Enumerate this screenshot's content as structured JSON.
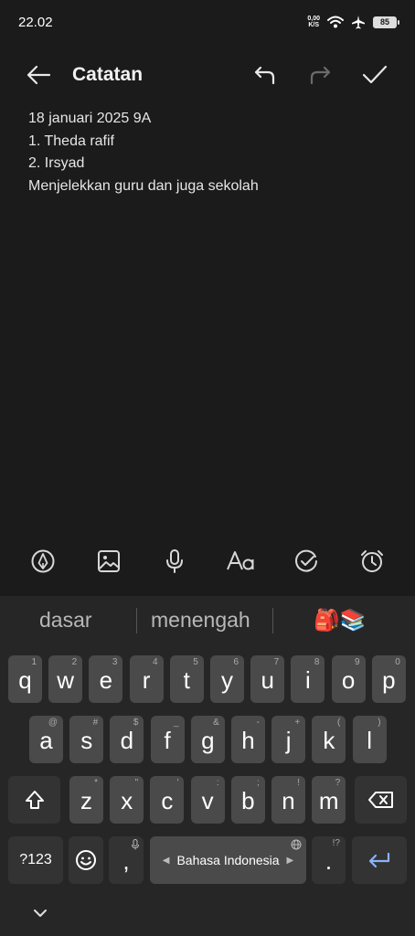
{
  "status_bar": {
    "time": "22.02",
    "net_speed_value": "0,00",
    "net_speed_unit": "K/S",
    "battery": "85"
  },
  "app_bar": {
    "title": "Catatan"
  },
  "note": {
    "lines": [
      "18 januari 2025 9A",
      "1. Theda rafif",
      "2. Irsyad",
      "Menjelekkan guru dan juga sekolah"
    ]
  },
  "keyboard": {
    "suggestions": [
      "dasar",
      "menengah",
      "🎒📚"
    ],
    "row1": [
      {
        "k": "q",
        "h": "1"
      },
      {
        "k": "w",
        "h": "2"
      },
      {
        "k": "e",
        "h": "3"
      },
      {
        "k": "r",
        "h": "4"
      },
      {
        "k": "t",
        "h": "5"
      },
      {
        "k": "y",
        "h": "6"
      },
      {
        "k": "u",
        "h": "7"
      },
      {
        "k": "i",
        "h": "8"
      },
      {
        "k": "o",
        "h": "9"
      },
      {
        "k": "p",
        "h": "0"
      }
    ],
    "row2": [
      {
        "k": "a",
        "h": "@"
      },
      {
        "k": "s",
        "h": "#"
      },
      {
        "k": "d",
        "h": "$"
      },
      {
        "k": "f",
        "h": "_"
      },
      {
        "k": "g",
        "h": "&"
      },
      {
        "k": "h",
        "h": "-"
      },
      {
        "k": "j",
        "h": "+"
      },
      {
        "k": "k",
        "h": "("
      },
      {
        "k": "l",
        "h": ")"
      }
    ],
    "row3": [
      {
        "k": "z",
        "h": "*"
      },
      {
        "k": "x",
        "h": "\""
      },
      {
        "k": "c",
        "h": "'"
      },
      {
        "k": "v",
        "h": ":"
      },
      {
        "k": "b",
        "h": ";"
      },
      {
        "k": "n",
        "h": "!"
      },
      {
        "k": "m",
        "h": "?"
      }
    ],
    "symbols_label": "?123",
    "comma_label": ",",
    "space_label": "Bahasa Indonesia",
    "period_label": ".",
    "period_hint": "!?"
  }
}
